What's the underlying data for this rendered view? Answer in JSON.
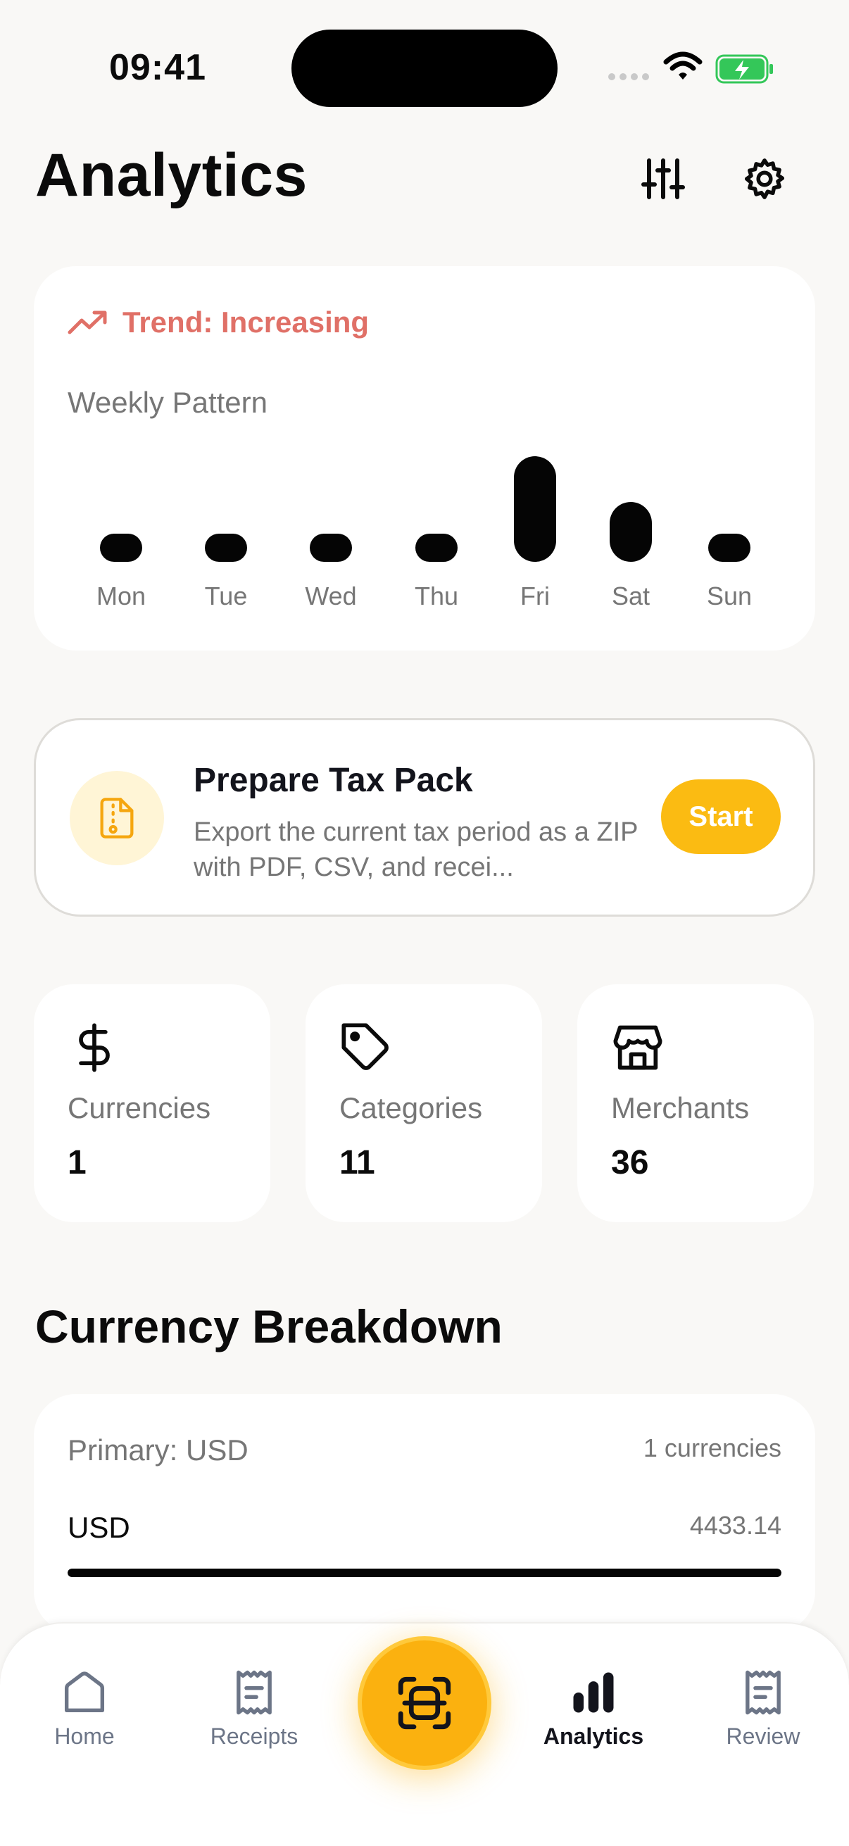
{
  "status_bar": {
    "time": "09:41"
  },
  "header": {
    "title": "Analytics",
    "filter_icon": "sliders-icon",
    "settings_icon": "gear-icon"
  },
  "trend_card": {
    "trend_label": "Trend: Increasing",
    "trend_color": "#e07067",
    "weekly_label": "Weekly Pattern"
  },
  "chart_data": {
    "type": "bar",
    "title": "Weekly Pattern",
    "categories": [
      "Mon",
      "Tue",
      "Wed",
      "Thu",
      "Fri",
      "Sat",
      "Sun"
    ],
    "values": [
      0.2,
      0.07,
      0.23,
      0.1,
      1.0,
      0.57,
      0.2
    ]
  },
  "tax_pack": {
    "title": "Prepare Tax Pack",
    "description": "Export the current tax period as a ZIP with PDF, CSV, and recei...",
    "button_label": "Start",
    "accent": "#fbbb12"
  },
  "stats": [
    {
      "label": "Currencies",
      "value": "1",
      "icon": "dollar-icon"
    },
    {
      "label": "Categories",
      "value": "11",
      "icon": "tag-icon"
    },
    {
      "label": "Merchants",
      "value": "36",
      "icon": "store-icon"
    }
  ],
  "currency_breakdown": {
    "title": "Currency Breakdown",
    "primary": "Primary: USD",
    "count": "1 currencies",
    "rows": [
      {
        "code": "USD",
        "amount": "4433.14",
        "share": 1.0
      }
    ]
  },
  "tabbar": {
    "tabs": [
      {
        "label": "Home",
        "icon": "home-icon"
      },
      {
        "label": "Receipts",
        "icon": "receipt-icon"
      },
      {
        "label": "Analytics",
        "icon": "bar-chart-icon",
        "active": true
      },
      {
        "label": "Review",
        "icon": "review-icon"
      }
    ],
    "scan_icon": "scan-icon"
  }
}
